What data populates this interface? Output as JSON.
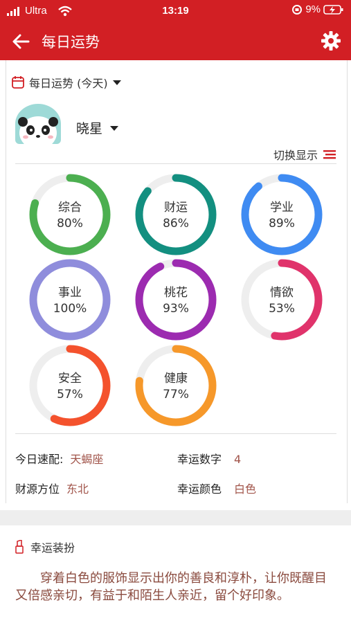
{
  "status": {
    "carrier": "Ultra",
    "time": "13:19",
    "battery": "9%"
  },
  "appbar": {
    "title": "每日运势"
  },
  "datebar": {
    "label": "每日运势 (今天)"
  },
  "user": {
    "name": "晓星"
  },
  "toggle": {
    "label": "切换显示"
  },
  "fortunes": [
    {
      "label": "综合",
      "percent": "80%",
      "value": 0.8,
      "color": "#4caf50"
    },
    {
      "label": "财运",
      "percent": "86%",
      "value": 0.86,
      "color": "#138f80"
    },
    {
      "label": "学业",
      "percent": "89%",
      "value": 0.89,
      "color": "#3f8bf2"
    },
    {
      "label": "事业",
      "percent": "100%",
      "value": 1.0,
      "color": "#8f8ddc"
    },
    {
      "label": "桃花",
      "percent": "93%",
      "value": 0.93,
      "color": "#9c2bb0"
    },
    {
      "label": "情欲",
      "percent": "53%",
      "value": 0.53,
      "color": "#e0336b"
    },
    {
      "label": "安全",
      "percent": "57%",
      "value": 0.57,
      "color": "#f4522d"
    },
    {
      "label": "健康",
      "percent": "77%",
      "value": 0.77,
      "color": "#f6982a"
    }
  ],
  "info": {
    "match_key": "今日速配:",
    "match_val": "天蝎座",
    "number_key": "幸运数字",
    "number_val": "4",
    "direction_key": "财源方位",
    "direction_val": "东北",
    "color_key": "幸运颜色",
    "color_val": "白色"
  },
  "dress": {
    "title": "幸运装扮",
    "text": "穿着白色的服饰显示出你的善良和淳朴，让你既醒目又倍感亲切，有益于和陌生人亲近，留个好印象。"
  }
}
